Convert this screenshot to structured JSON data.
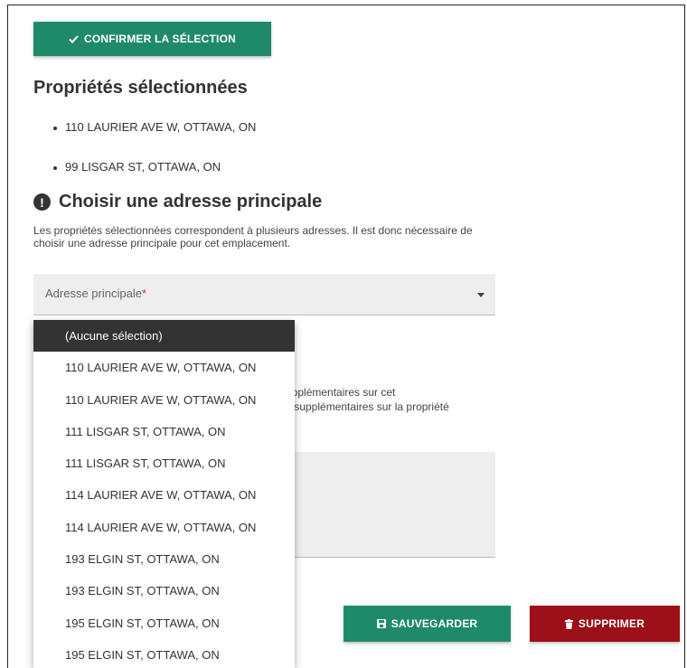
{
  "confirm_button": {
    "label": "CONFIRMER LA SÉLECTION"
  },
  "selected_section": {
    "title": "Propriétés sélectionnées",
    "items": [
      "110 LAURIER AVE W, OTTAWA, ON",
      "99 LISGAR ST, OTTAWA, ON"
    ]
  },
  "primary_address": {
    "title": "Choisir une adresse principale",
    "description": "Les propriétés sélectionnées correspondent à plusieurs adresses. Il est donc nécessaire de choisir une adresse principale pour cet emplacement.",
    "select": {
      "label": "Adresse principale",
      "required_mark": "*"
    }
  },
  "partial_text": {
    "line1": "upplémentaires sur cet",
    "line2": "s supplémentaires sur la propriété"
  },
  "dropdown": {
    "selected": "(Aucune sélection)",
    "options": [
      "(Aucune sélection)",
      "110 LAURIER AVE W, OTTAWA, ON",
      "110 LAURIER AVE W, OTTAWA, ON",
      "111 LISGAR ST, OTTAWA, ON",
      "111 LISGAR ST, OTTAWA, ON",
      "114 LAURIER AVE W, OTTAWA, ON",
      "114 LAURIER AVE W, OTTAWA, ON",
      "193 ELGIN ST, OTTAWA, ON",
      "193 ELGIN ST, OTTAWA, ON",
      "195 ELGIN ST, OTTAWA, ON",
      "195 ELGIN ST, OTTAWA, ON"
    ]
  },
  "actions": {
    "save_label": "SAUVEGARDER",
    "delete_label": "SUPPRIMER"
  },
  "colors": {
    "primary": "#1f8a6a",
    "danger": "#9b1018",
    "dropdown_selected": "#333333"
  },
  "icons": {
    "confirm": "check-icon",
    "warning": "exclamation-circle-icon",
    "select": "caret-down-icon",
    "save": "floppy-disk-icon",
    "delete": "trash-icon"
  }
}
